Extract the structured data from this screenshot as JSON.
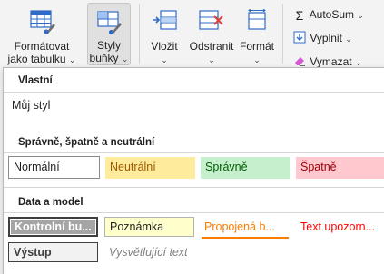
{
  "ribbon": {
    "format_as_table": {
      "line1": "Formátovat",
      "line2": "jako tabulku",
      "chevron": "⌄"
    },
    "cell_styles": {
      "line1": "Styly",
      "line2": "buňky",
      "chevron": "⌄"
    },
    "insert": {
      "label": "Vložit",
      "chevron": "⌄"
    },
    "delete": {
      "label": "Odstranit",
      "chevron": "⌄"
    },
    "format": {
      "label": "Formát",
      "chevron": "⌄"
    },
    "autosum": {
      "icon": "Σ",
      "label": "AutoSum",
      "chevron": "⌄"
    },
    "fill": {
      "label": "Vyplnit",
      "chevron": "⌄"
    },
    "clear": {
      "label": "Vymazat",
      "chevron": "⌄"
    }
  },
  "gallery": {
    "custom": {
      "heading": "Vlastní",
      "items": [
        "Můj styl"
      ]
    },
    "good_bad_neutral": {
      "heading": "Správně, špatně a neutrální",
      "items": [
        "Normální",
        "Neutrální",
        "Správně",
        "Špatně"
      ]
    },
    "data_model": {
      "heading": "Data a model",
      "row1": [
        "Kontrolní bu...",
        "Poznámka",
        "Propojená b...",
        "Text upozorn..."
      ],
      "row2": [
        "Výstup",
        "Vysvětlující text"
      ]
    }
  },
  "colors": {
    "neutral_fill": "#ffeb9c",
    "good_fill": "#c6efce",
    "bad_fill": "#ffc7ce",
    "check_fill": "#a5a5a5",
    "note_fill": "#ffffcc",
    "linked_text": "#fa7d00",
    "warning_text": "#ff0000"
  }
}
